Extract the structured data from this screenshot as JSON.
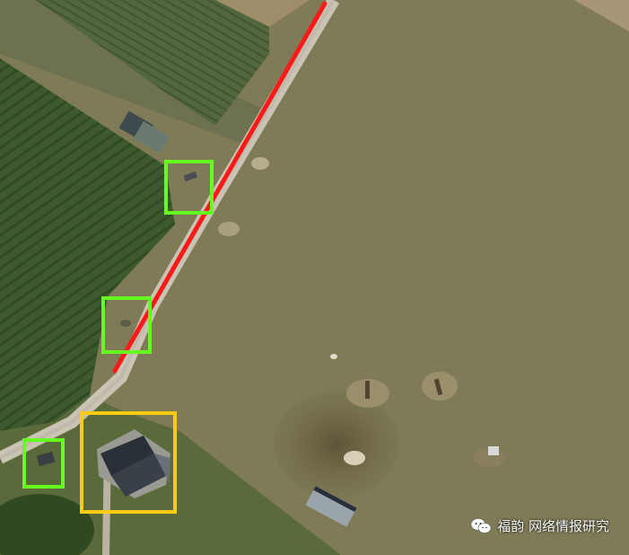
{
  "map": {
    "imagery": "satellite",
    "route_line": {
      "color": "#ff1a1a"
    },
    "markers": [
      {
        "name": "vehicle-marker-1",
        "color": "#66ff22"
      },
      {
        "name": "vehicle-marker-2",
        "color": "#66ff22"
      },
      {
        "name": "vehicle-marker-3",
        "color": "#66ff22"
      },
      {
        "name": "building-marker",
        "color": "#ffcc11"
      }
    ]
  },
  "watermark": {
    "icon": "wechat-icon",
    "text": "福韵 网络情报研究"
  }
}
